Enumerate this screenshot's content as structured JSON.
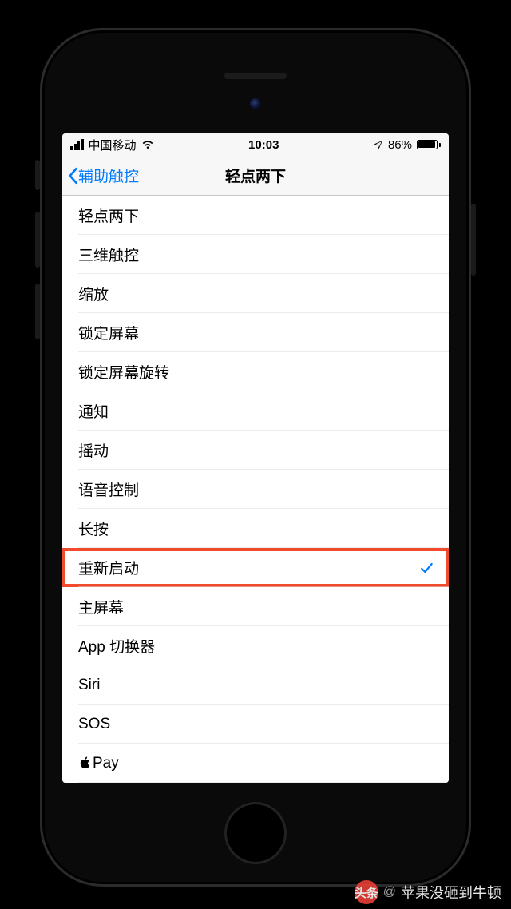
{
  "status": {
    "carrier": "中国移动",
    "time": "10:03",
    "battery_pct": "86%"
  },
  "nav": {
    "back_label": "辅助触控",
    "title": "轻点两下"
  },
  "list": {
    "items": [
      {
        "label": "轻点两下",
        "selected": false,
        "highlight": false
      },
      {
        "label": "三维触控",
        "selected": false,
        "highlight": false
      },
      {
        "label": "缩放",
        "selected": false,
        "highlight": false
      },
      {
        "label": "锁定屏幕",
        "selected": false,
        "highlight": false
      },
      {
        "label": "锁定屏幕旋转",
        "selected": false,
        "highlight": false
      },
      {
        "label": "通知",
        "selected": false,
        "highlight": false
      },
      {
        "label": "摇动",
        "selected": false,
        "highlight": false
      },
      {
        "label": "语音控制",
        "selected": false,
        "highlight": false
      },
      {
        "label": "长按",
        "selected": false,
        "highlight": false
      },
      {
        "label": "重新启动",
        "selected": true,
        "highlight": true
      },
      {
        "label": "主屏幕",
        "selected": false,
        "highlight": false
      },
      {
        "label": "App 切换器",
        "selected": false,
        "highlight": false
      },
      {
        "label": "Siri",
        "selected": false,
        "highlight": false
      },
      {
        "label": "SOS",
        "selected": false,
        "highlight": false
      },
      {
        "label": "Pay",
        "selected": false,
        "highlight": false,
        "apple_prefix": true
      }
    ]
  },
  "watermark": {
    "badge": "头条",
    "at": "@",
    "name": "苹果没砸到牛顿"
  }
}
